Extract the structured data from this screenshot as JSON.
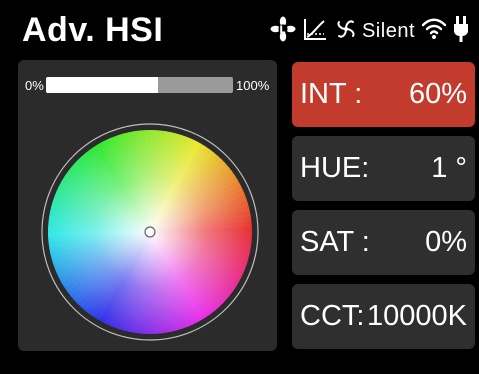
{
  "header": {
    "title": "Adv. HSI",
    "fan_mode": "Silent"
  },
  "intensity_bar": {
    "min_label": "0%",
    "max_label": "100%",
    "level": 0.6
  },
  "controls": [
    {
      "label": "INT :",
      "value": "60%",
      "active": true
    },
    {
      "label": "HUE:",
      "value": "1 °",
      "active": false
    },
    {
      "label": "SAT :",
      "value": "0%",
      "active": false
    },
    {
      "label": "CCT:",
      "value": "10000K",
      "active": false
    }
  ],
  "colors": {
    "active": "#c23b2c",
    "panel": "#2b2b2b",
    "button": "#2f2f2f"
  }
}
